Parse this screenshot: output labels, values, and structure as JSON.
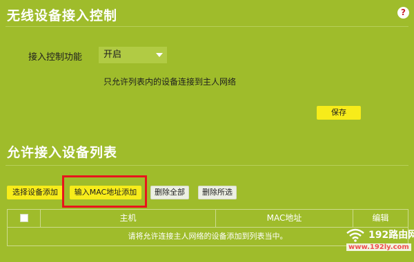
{
  "section1": {
    "title": "无线设备接入控制",
    "help_icon": "question-mark-icon",
    "access_control_label": "接入控制功能",
    "access_control_value": "开启",
    "hint": "只允许列表内的设备连接到主人网络",
    "save_label": "保存"
  },
  "section2": {
    "title": "允许接入设备列表",
    "buttons": {
      "select_device_add": "选择设备添加",
      "input_mac_add": "输入MAC地址添加",
      "delete_all": "删除全部",
      "delete_selected": "删除所选"
    },
    "table": {
      "headers": [
        "主机",
        "MAC地址",
        "编辑"
      ],
      "empty_message": "请将允许连接主人网络的设备添加到列表当中。"
    }
  },
  "watermark": {
    "name": "192路由网",
    "url": "www.192ly.com"
  },
  "colors": {
    "background": "#9fbc2b",
    "button_yellow": "#f7ec1a",
    "highlight_red": "#e8141c"
  }
}
